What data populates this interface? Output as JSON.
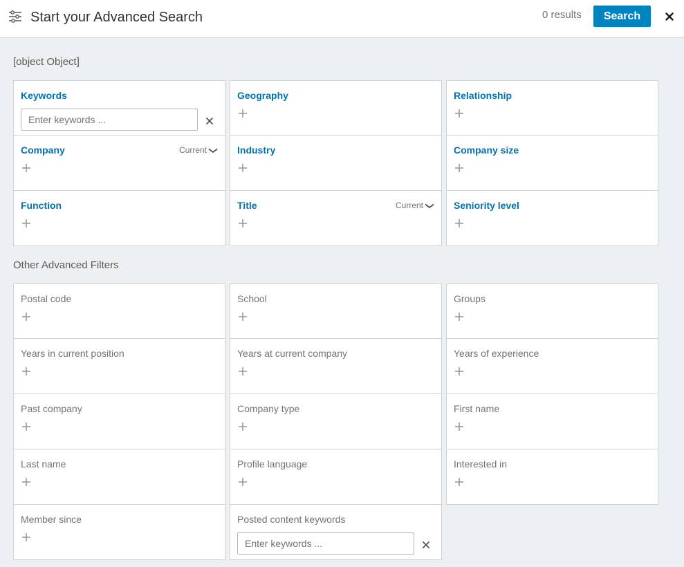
{
  "header": {
    "title": "Start your Advanced Search",
    "result_count": "0 results",
    "search_label": "Search"
  },
  "top_filters": {
    "title": {
      "label": "Title",
      "scope": "Current"
    },
    "keywords": {
      "label": "Keywords",
      "placeholder": "Enter keywords ...",
      "value": ""
    },
    "geography": {
      "label": "Geography"
    },
    "relationship": {
      "label": "Relationship"
    },
    "company": {
      "label": "Company",
      "scope": "Current"
    },
    "industry": {
      "label": "Industry"
    },
    "company_size": {
      "label": "Company size"
    },
    "function": {
      "label": "Function"
    },
    "seniority_level": {
      "label": "Seniority level"
    }
  },
  "other_filters": {
    "title": "Other Advanced Filters",
    "postal_code": {
      "label": "Postal code"
    },
    "school": {
      "label": "School"
    },
    "groups": {
      "label": "Groups"
    },
    "years_in_current_position": {
      "label": "Years in current position"
    },
    "years_at_current_company": {
      "label": "Years at current company"
    },
    "years_of_experience": {
      "label": "Years of experience"
    },
    "past_company": {
      "label": "Past company"
    },
    "company_type": {
      "label": "Company type"
    },
    "first_name": {
      "label": "First name"
    },
    "last_name": {
      "label": "Last name"
    },
    "profile_language": {
      "label": "Profile language"
    },
    "interested_in": {
      "label": "Interested in"
    },
    "member_since": {
      "label": "Member since"
    },
    "posted_content_keywords": {
      "label": "Posted content keywords",
      "placeholder": "Enter keywords ...",
      "value": ""
    }
  }
}
